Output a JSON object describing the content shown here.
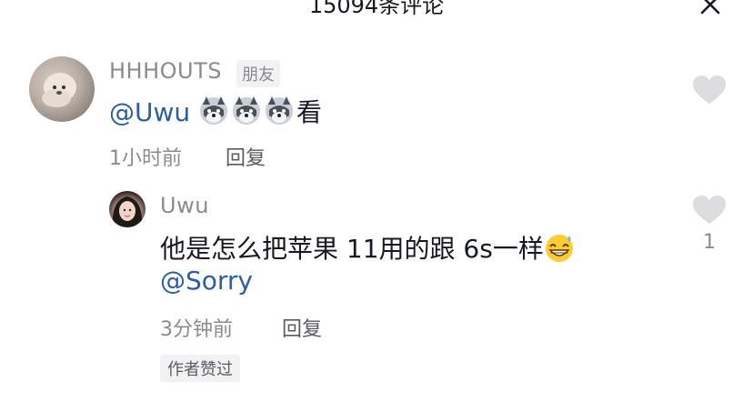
{
  "header": {
    "title": "15094条评论"
  },
  "comments": [
    {
      "username": "HHHOUTS",
      "badge": "朋友",
      "mention": "@Uwu",
      "text_suffix": "看",
      "emojis": [
        "husky-emoji",
        "husky-emoji",
        "husky-emoji"
      ],
      "time": "1小时前",
      "reply_label": "回复"
    },
    {
      "username": "Uwu",
      "text": "他是怎么把苹果 11用的跟 6s一样",
      "emoji": "grin-sweat-emoji",
      "mention": "@Sorry",
      "time": "3分钟前",
      "reply_label": "回复",
      "author_liked": "作者赞过",
      "like_count": "1"
    }
  ],
  "colors": {
    "mention": "#2c5e9e",
    "meta": "#8a8b91",
    "text": "#161823",
    "like_icon": "#dcdcdf"
  }
}
